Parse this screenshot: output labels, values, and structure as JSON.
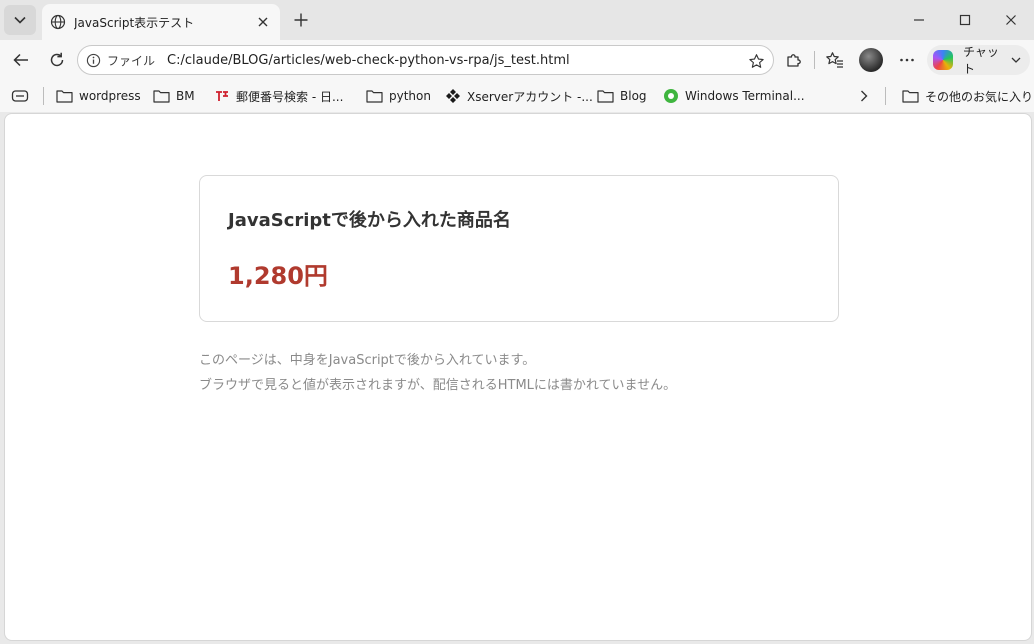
{
  "tab": {
    "title": "JavaScript表示テスト"
  },
  "address_bar": {
    "scheme_label": "ファイル",
    "url": "C:/claude/BLOG/articles/web-check-python-vs-rpa/js_test.html"
  },
  "copilot": {
    "label": "チャット"
  },
  "bookmarks": [
    {
      "label": "wordpress",
      "icon": "folder-icon"
    },
    {
      "label": "BM",
      "icon": "folder-icon"
    },
    {
      "label": "郵便番号検索 - 日...",
      "icon": "jp-post-icon"
    },
    {
      "label": "python",
      "icon": "folder-icon"
    },
    {
      "label": "Xserverアカウント -...",
      "icon": "xserver-icon"
    },
    {
      "label": "Blog",
      "icon": "folder-icon"
    },
    {
      "label": "Windows Terminal...",
      "icon": "terminal-icon"
    }
  ],
  "other_bookmarks": {
    "label": "その他のお気に入り"
  },
  "content": {
    "product_name": "JavaScriptで後から入れた商品名",
    "price": "1,280円",
    "note_line1": "このページは、中身をJavaScriptで後から入れています。",
    "note_line2": "ブラウザで見ると値が表示されますが、配信されるHTMLには書かれていません。"
  },
  "colors": {
    "price": "#b03a2e",
    "card_border": "#d9d9d9",
    "note_text": "#8a8a8a"
  }
}
